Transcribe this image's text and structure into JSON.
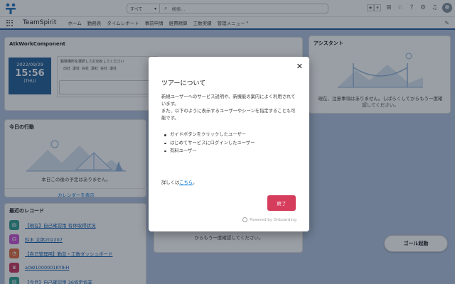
{
  "header": {
    "search_scope": "すべて",
    "search_placeholder": "検索..."
  },
  "nav": {
    "app_name": "TeamSpirit",
    "items": [
      {
        "label": "ホーム",
        "active": true
      },
      {
        "label": "勤務表"
      },
      {
        "label": "タイムレポート"
      },
      {
        "label": "事前申請"
      },
      {
        "label": "経費精算"
      },
      {
        "label": "工数実績"
      },
      {
        "label": "管理メニュー",
        "dropdown": true
      }
    ]
  },
  "atk": {
    "title": "AtkWorkComponent",
    "date": "2022/09/29",
    "time": "15:56",
    "weekday": "(THU)",
    "message": "勤務場所を選択して打刻をしてください",
    "stamp_buttons": [
      "出社",
      "退社",
      "在社",
      "退社",
      "在社",
      "退社"
    ]
  },
  "today": {
    "title": "今日の行動",
    "message": "本日この後の予定はありません。",
    "link": "カレンダーを表示"
  },
  "recent": {
    "title": "最近のレコード",
    "items": [
      {
        "label": "【現在】自己確認用 有休取得状況",
        "color": "#2a9d8f",
        "icon": "clipboard-icon"
      },
      {
        "label": "鈴木 太郎202207",
        "color": "#c94fd1",
        "icon": "headset-icon"
      },
      {
        "label": "【自己管理用】勤怠・工数ダッシュボード",
        "color": "#e06a3a",
        "icon": "dashboard-icon"
      },
      {
        "label": "a0W1000001KY9iH",
        "color": "#c9315a",
        "icon": "trophy-icon"
      },
      {
        "label": "【今月】自己確認用 36協定協業",
        "color": "#2a9d8f",
        "icon": "clipboard-icon"
      }
    ]
  },
  "assistant": {
    "title": "アシスタント",
    "message": "現在、注意事項はありません。しばらくしてからもう一度確認してください。"
  },
  "middle": {
    "message": "からもう一度確認してください。"
  },
  "goal_button": "ゴール起動",
  "modal": {
    "title": "ツアーについて",
    "para1": "新規ユーザーへのサービス説明や、新機能の案内によく利用されています。",
    "para2": "また、以下のように表示するユーザーやシーンを指定することも可能です。",
    "list": [
      "ガイドボタンをクリックしたユーザー",
      "はじめてサービスにログインしたユーザー",
      "有料ユーザー"
    ],
    "more_prefix": "詳しくは",
    "more_link": "こちら",
    "more_suffix": "。",
    "finish_button": "終了",
    "powered_by": "Powered by Onboarding"
  }
}
